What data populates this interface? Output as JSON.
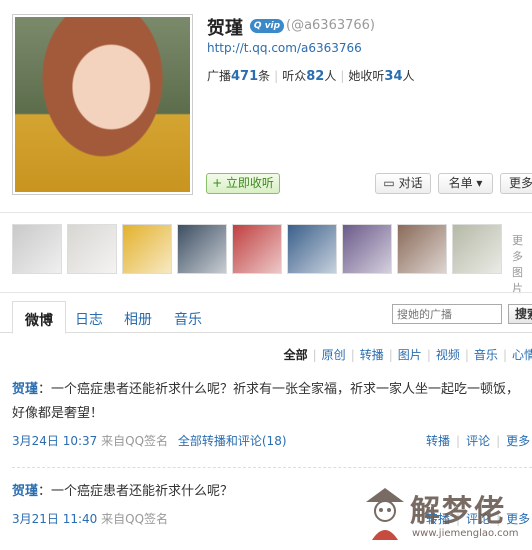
{
  "profile": {
    "name": "贺瑾",
    "badge": "Q vip",
    "handle": "(@a6363766)",
    "url": "http://t.qq.com/a6363766",
    "stats": {
      "broadcast_label": "广播",
      "broadcast_count": "471",
      "broadcast_unit": "条",
      "listen_label": "听众",
      "listen_count": "82",
      "listen_unit": "人",
      "follow_label": "她收听",
      "follow_count": "34",
      "follow_unit": "人"
    }
  },
  "actions": {
    "follow": "+ 立即收听",
    "chat": "对话",
    "list": "名单 ▾",
    "more": "更多"
  },
  "thumbnails": {
    "colors": [
      "#c9c9c9",
      "#d8d6d2",
      "#e3b12c",
      "#3d4f63",
      "#c04040",
      "#3b5f8a",
      "#6b5a8a",
      "#8a6b5a",
      "#b5b9a6"
    ],
    "more_label_1": "更多",
    "more_label_2": "图片"
  },
  "tabs": [
    {
      "label": "微博"
    },
    {
      "label": "日志"
    },
    {
      "label": "相册"
    },
    {
      "label": "音乐"
    }
  ],
  "search": {
    "placeholder": "搜她的广播",
    "button": "搜索"
  },
  "filters": [
    "全部",
    "原创",
    "转播",
    "图片",
    "视频",
    "音乐",
    "心情"
  ],
  "posts": [
    {
      "author": "贺瑾",
      "body": "：一个癌症患者还能祈求什么呢？祈求有一张全家福，祈求一家人坐一起吃一顿饭，好像都是奢望！",
      "time": "3月24日 10:37",
      "source": "来自QQ签名",
      "link": "全部转播和评论(18)",
      "acts": [
        "转播",
        "评论",
        "更多"
      ]
    },
    {
      "author": "贺瑾",
      "body": "：一个癌症患者还能祈求什么呢？",
      "time": "3月21日 11:40",
      "source": "来自QQ签名",
      "acts": [
        "转播",
        "评论",
        "更多"
      ]
    }
  ],
  "watermark": {
    "title": "解梦佬",
    "site": "www.jiemenglao.com"
  },
  "colors": {
    "link": "#2a6db0",
    "accent_green": "#3d8b1f"
  }
}
